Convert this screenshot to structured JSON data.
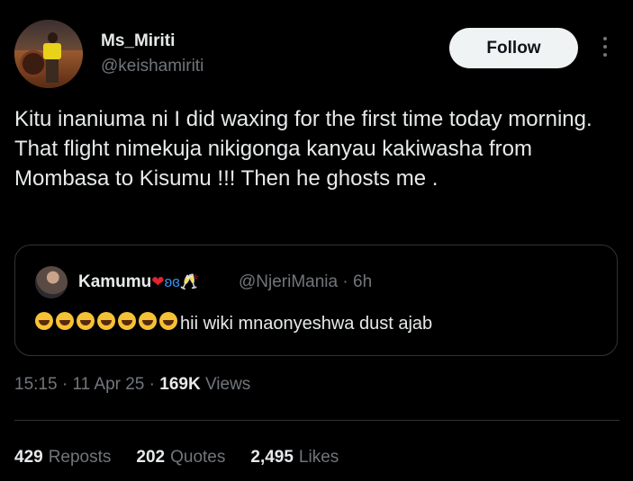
{
  "author": {
    "name": "Ms_Miriti",
    "handle": "@keishamiriti"
  },
  "follow_label": "Follow",
  "tweet_text": "Kitu inaniuma ni I did waxing for the first time today morning. That flight nimekuja nikigonga kanyau kakiwasha from Mombasa to Kisumu !!! Then he ghosts me .",
  "quote": {
    "name": "Kamumu",
    "name_emojis": "heart butterfly champagne",
    "handle": "@NjeriMania",
    "time": "6h",
    "laugh_emoji_count": 7,
    "text": "hii wiki mnaonyeshwa dust ajab"
  },
  "meta": {
    "time": "15:15",
    "date": "11 Apr 25",
    "views_count": "169K",
    "views_label": "Views"
  },
  "stats": {
    "reposts_count": "429",
    "reposts_label": "Reposts",
    "quotes_count": "202",
    "quotes_label": "Quotes",
    "likes_count": "2,495",
    "likes_label": "Likes"
  }
}
